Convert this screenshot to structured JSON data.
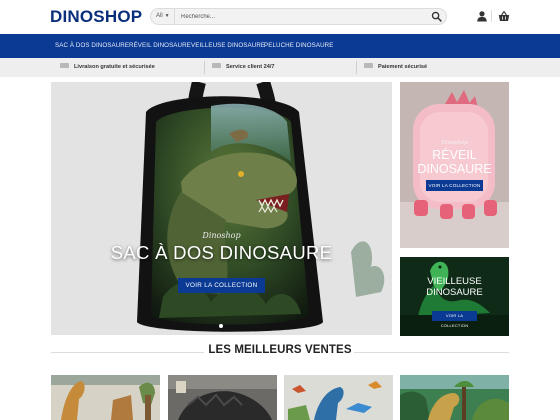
{
  "header": {
    "logo": "DINOSHOP",
    "search_category": "All",
    "search_placeholder": "Recherche...",
    "icons": [
      "search-icon",
      "user-icon",
      "cart-icon"
    ]
  },
  "nav": {
    "items": [
      "SAC À DOS DINOSAURE",
      "RÉVEIL DINOSAURE",
      "VEILLEUSE DINOSAURE",
      "PELUCHE DINOSAURE"
    ]
  },
  "benefits": {
    "items": [
      "Livraison gratuite et sécurisée",
      "Service client 24/7",
      "Paiement sécurisé"
    ]
  },
  "hero": {
    "brand": "Dinoshop",
    "title": "SAC À DOS DINOSAURE",
    "button": "VOIR LA COLLECTION"
  },
  "tiles": {
    "reveil": {
      "brand": "Dinoshop",
      "title_line1": "RÉVEIL",
      "title_line2": "DINOSAURE",
      "button": "VOIR LA COLLECTION"
    },
    "veilleuse": {
      "brand": "Dinoshop",
      "title_line1": "VIEILLEUSE",
      "title_line2": "DINOSAURE",
      "button": "VOIR LA COLLECTION"
    }
  },
  "best_sellers": {
    "title": "LES MEILLEURS VENTES"
  },
  "colors": {
    "brand_blue": "#0a3a94",
    "logo_blue": "#0a2f7a",
    "benefit_bar": "#eeeeee"
  }
}
